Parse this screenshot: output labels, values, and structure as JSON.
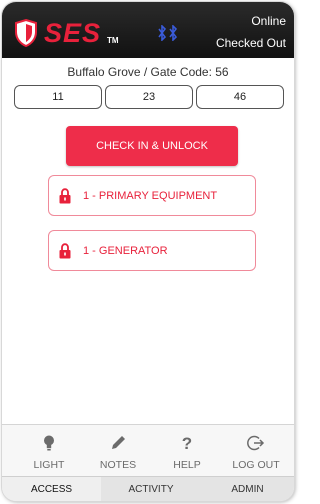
{
  "header": {
    "logo_text": "SES",
    "trademark": "TM",
    "status_online": "Online",
    "status_checked": "Checked Out"
  },
  "location": "Buffalo Grove / Gate Code: 56",
  "codes": [
    "11",
    "23",
    "46"
  ],
  "check_in_label": "CHECK IN & UNLOCK",
  "locks": [
    {
      "label": "1 - PRIMARY EQUIPMENT"
    },
    {
      "label": "1 - GENERATOR"
    }
  ],
  "toolbar": {
    "light": "LIGHT",
    "notes": "NOTES",
    "help": "HELP",
    "logout": "LOG OUT"
  },
  "tabs": {
    "access": "ACCESS",
    "activity": "ACTIVITY",
    "admin": "ADMIN"
  },
  "icons": {
    "light": "lightbulb-icon",
    "notes": "pencil-icon",
    "help": "question-icon",
    "logout": "logout-icon",
    "lock": "lock-icon",
    "bluetooth": "bluetooth-icon",
    "shield": "shield-icon"
  },
  "colors": {
    "brand_red": "#ee2d4a",
    "header_bg": "#1a1a1a",
    "bluetooth_blue": "#3a5bd9"
  }
}
